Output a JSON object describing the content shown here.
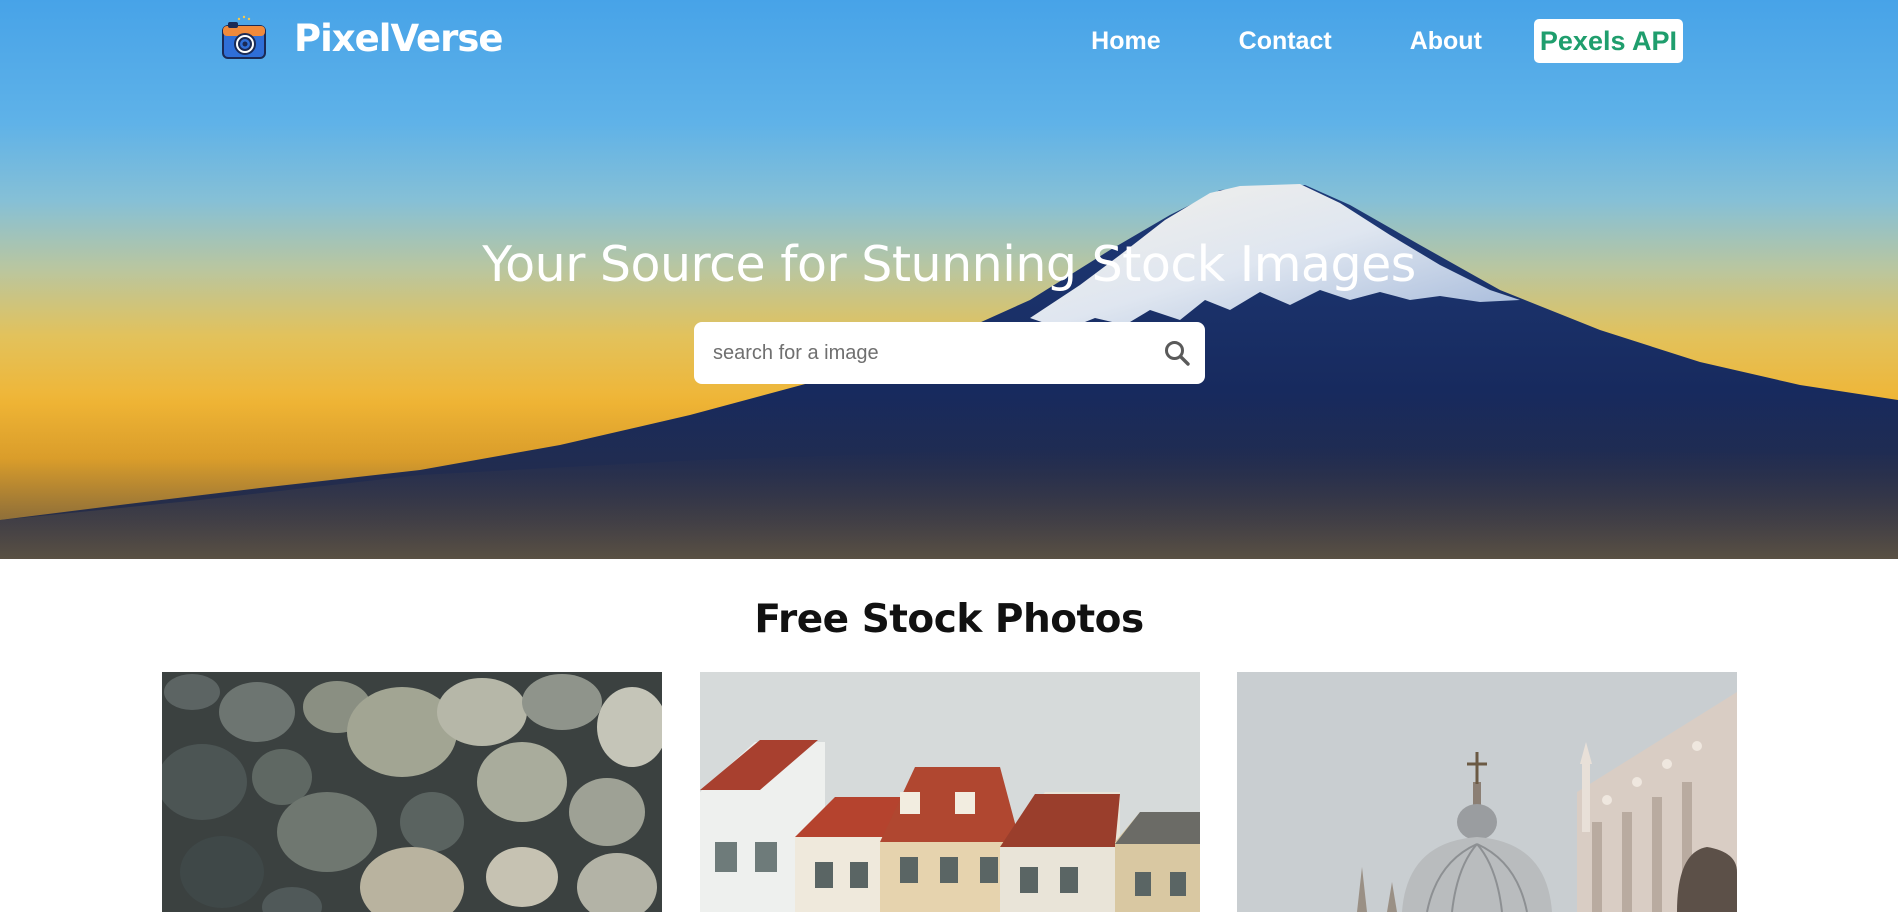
{
  "brand": {
    "name": "PixelVerse",
    "logo_icon": "camera-icon"
  },
  "nav": {
    "links": [
      "Home",
      "Contact",
      "About"
    ],
    "api_label": "Pexels API"
  },
  "hero": {
    "title": "Your Source for Stunning Stock Images",
    "search_placeholder": "search for a image",
    "search_icon": "search-icon"
  },
  "section": {
    "title": "Free Stock Photos",
    "photos": [
      {
        "subject": "pebble stones"
      },
      {
        "subject": "colorful townhouses"
      },
      {
        "subject": "dome and palace facade"
      }
    ]
  },
  "colors": {
    "api_text": "#1f9e6d",
    "sky_top": "#47a3e8",
    "horizon": "#f0b535",
    "mountain": "#16295c"
  }
}
